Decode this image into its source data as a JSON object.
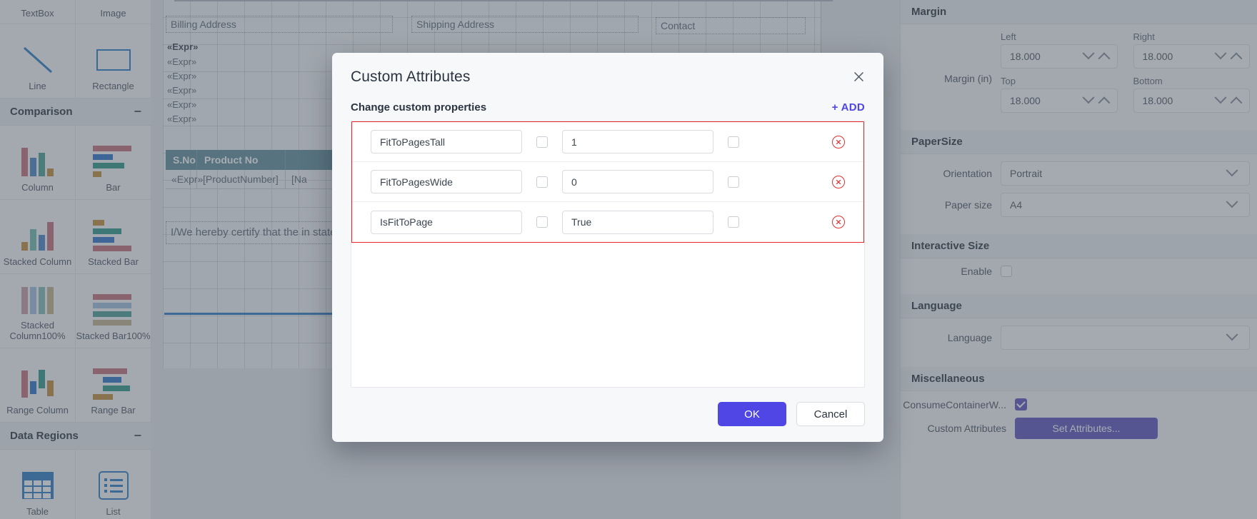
{
  "toolbox": {
    "items": [
      {
        "label": "TextBox",
        "icon": "textbox-icon"
      },
      {
        "label": "Image",
        "icon": "image-icon"
      },
      {
        "label": "Line",
        "icon": "line-icon"
      },
      {
        "label": "Rectangle",
        "icon": "rectangle-icon"
      }
    ],
    "sections": [
      {
        "label": "Comparison",
        "collapse": "−"
      },
      {
        "label": "Data Regions",
        "collapse": "−"
      }
    ],
    "comparison_items": [
      {
        "label": "Column",
        "icon": "column-chart-icon"
      },
      {
        "label": "Bar",
        "icon": "bar-chart-icon"
      },
      {
        "label": "Stacked Column",
        "icon": "stacked-column-chart-icon"
      },
      {
        "label": "Stacked Bar",
        "icon": "stacked-bar-chart-icon"
      },
      {
        "label": "Stacked Column100%",
        "icon": "stacked-column-100-icon"
      },
      {
        "label": "Stacked Bar100%",
        "icon": "stacked-bar-100-icon"
      },
      {
        "label": "Range Column",
        "icon": "range-column-chart-icon"
      },
      {
        "label": "Range Bar",
        "icon": "range-bar-chart-icon"
      }
    ],
    "data_region_items": [
      {
        "label": "Table",
        "icon": "table-icon"
      },
      {
        "label": "List",
        "icon": "list-icon"
      }
    ]
  },
  "canvas": {
    "headers": {
      "billing": "Billing Address",
      "shipping": "Shipping Address",
      "contact": "Contact"
    },
    "expressions": [
      "«Expr»",
      "«Expr»",
      "«Expr»",
      "«Expr»",
      "«Expr»",
      "«Expr»"
    ],
    "table": {
      "columns": [
        "S.No",
        "Product No",
        ""
      ],
      "row": [
        "«Expr»",
        "[ProductNumber]",
        "[Na"
      ]
    },
    "certify_text": "I/We hereby certify that the in stated above."
  },
  "properties": {
    "margin": {
      "section": "Margin",
      "row_label": "Margin (in)",
      "fields": [
        {
          "label": "Left",
          "value": "18.000"
        },
        {
          "label": "Right",
          "value": "18.000"
        },
        {
          "label": "Top",
          "value": "18.000"
        },
        {
          "label": "Bottom",
          "value": "18.000"
        }
      ]
    },
    "paper_size": {
      "section": "PaperSize",
      "orientation_label": "Orientation",
      "orientation_value": "Portrait",
      "paper_label": "Paper size",
      "paper_value": "A4"
    },
    "interactive_size": {
      "section": "Interactive Size",
      "enable_label": "Enable",
      "enable_checked": false
    },
    "language": {
      "section": "Language",
      "label": "Language",
      "value": ""
    },
    "misc": {
      "section": "Miscellaneous",
      "consume_label": "ConsumeContainerW...",
      "consume_checked": true,
      "custom_attr_label": "Custom Attributes",
      "set_attr_button": "Set Attributes..."
    }
  },
  "modal": {
    "title": "Custom Attributes",
    "close_icon": "close-icon",
    "subtitle": "Change custom properties",
    "add_label": "+ ADD",
    "accent_color": "#4f46e5",
    "error_border_color": "#e8272a",
    "delete_icon_color": "#e03131",
    "rows": [
      {
        "name": "FitToPagesTall",
        "name_checked": false,
        "value": "1",
        "value_checked": false,
        "delete_icon": "delete-circle-icon"
      },
      {
        "name": "FitToPagesWide",
        "name_checked": false,
        "value": "0",
        "value_checked": false,
        "delete_icon": "delete-circle-icon"
      },
      {
        "name": "IsFitToPage",
        "name_checked": false,
        "value": "True",
        "value_checked": false,
        "delete_icon": "delete-circle-icon"
      }
    ],
    "ok_label": "OK",
    "cancel_label": "Cancel"
  }
}
